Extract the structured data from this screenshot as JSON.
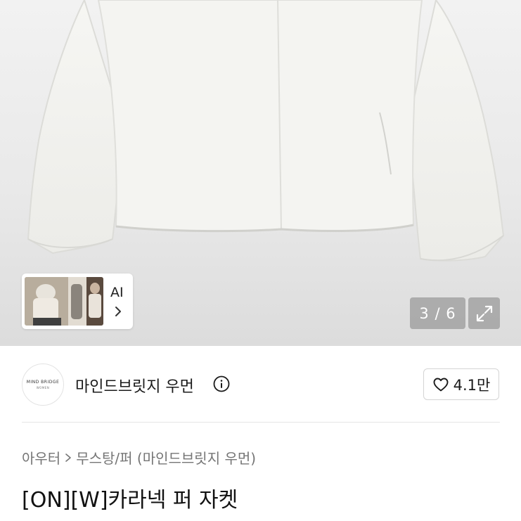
{
  "gallery": {
    "ai_chip_label": "AI",
    "counter": "3 / 6"
  },
  "brand": {
    "logo_line1": "MIND BRIDGE",
    "logo_line2": "WOMEN",
    "name": "마인드브릿지 우먼",
    "likes": "4.1만"
  },
  "breadcrumb": {
    "category": "아우터",
    "subcategory": "무스탕/퍼 (마인드브릿지 우먼)"
  },
  "product": {
    "title": "[ON][W]카라넥 퍼 자켓"
  },
  "icons": [
    "chevron-right-icon",
    "expand-icon",
    "info-icon",
    "heart-icon"
  ],
  "colors": {
    "overlay_button": "#8a8a8a",
    "text_primary": "#1a1a1a",
    "text_secondary": "#757575"
  }
}
